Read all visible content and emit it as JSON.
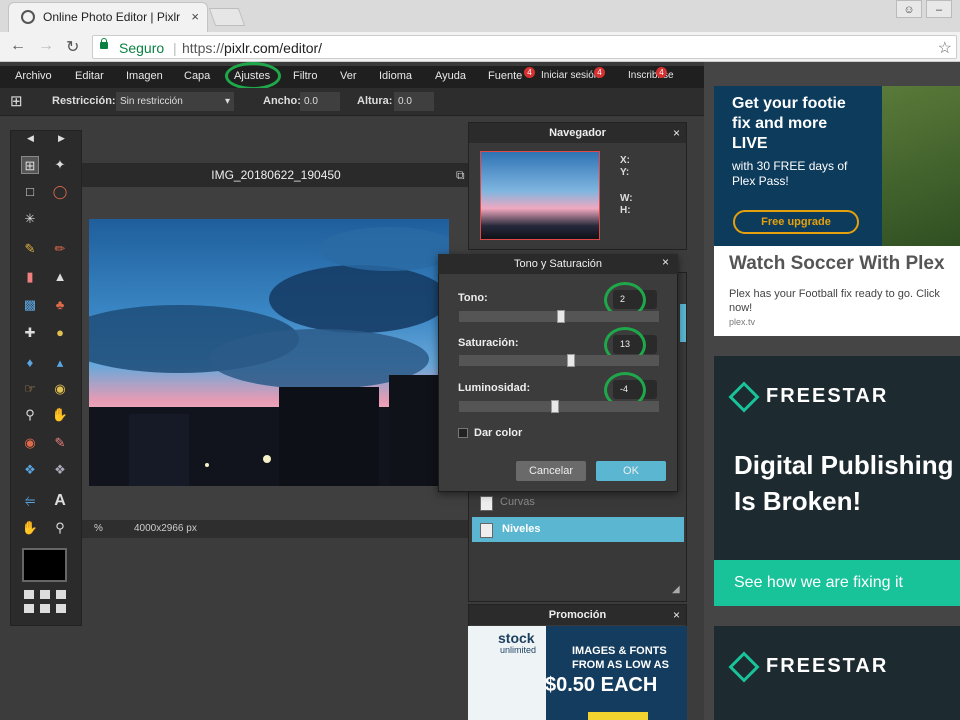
{
  "browser": {
    "tab_title": "Online Photo Editor | Pixlr",
    "tab_close": "×",
    "secure_label": "Seguro",
    "url_scheme": "https://",
    "url_host": "pixlr.com/editor/"
  },
  "menu": {
    "items": [
      "Archivo",
      "Editar",
      "Imagen",
      "Capa",
      "Ajustes",
      "Filtro",
      "Ver",
      "Idioma",
      "Ayuda",
      "Fuente"
    ],
    "highlighted": "Ajustes",
    "login": "Iniciar sesión",
    "register": "Inscribirse",
    "badges": [
      "4",
      "4",
      "4"
    ]
  },
  "options": {
    "restriccion_label": "Restricción:",
    "restriccion_value": "Sin restricción",
    "ancho_label": "Ancho:",
    "ancho_value": "0.0",
    "altura_label": "Altura:",
    "altura_value": "0.0"
  },
  "document": {
    "title": "IMG_20180622_190450",
    "zoom": "%",
    "size": "4000x2966 px"
  },
  "navigator": {
    "title": "Navegador",
    "x": "X:",
    "y": "Y:",
    "w": "W:",
    "h": "H:"
  },
  "history": {
    "rows": [
      "Curvas",
      "Niveles"
    ]
  },
  "promo": {
    "title": "Promoción",
    "line1": "IMAGES & FONTS",
    "line2": "FROM AS LOW AS",
    "price": "$0.50 EACH",
    "brand": "stock",
    "brand2": "unlimited"
  },
  "dialog": {
    "title": "Tono y Saturación",
    "tono_label": "Tono:",
    "tono_value": "2",
    "saturacion_label": "Saturación:",
    "saturacion_value": "13",
    "luminosidad_label": "Luminosidad:",
    "luminosidad_value": "-4",
    "colorize_label": "Dar color",
    "cancel": "Cancelar",
    "ok": "OK",
    "close": "×",
    "tono_level": 0.51,
    "saturacion_level": 0.56,
    "luminosidad_level": 0.48
  },
  "ads": {
    "ad1_headline": "Get your footie fix and more LIVE",
    "ad1_sub": "with 30 FREE days of Plex Pass!",
    "ad1_cta": "Free upgrade",
    "ad1_title": "Watch Soccer With Plex",
    "ad1_body": "Plex has your Football fix ready to go. Click now!",
    "ad1_domain": "plex.tv",
    "ad2_brand": "FREESTAR",
    "ad2_headline1": "Digital Publishing",
    "ad2_headline2": "Is Broken!",
    "ad2_cta": "See how we are fixing it",
    "ad3_brand": "FREESTAR"
  },
  "colors": {
    "accent_highlight": "#1fa84a",
    "history_selected": "#5bb6d1",
    "ok_button": "#5bb6d1",
    "freestar": "#19c39a"
  }
}
